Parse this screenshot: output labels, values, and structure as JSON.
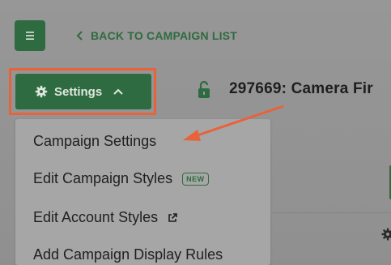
{
  "header": {
    "back_label": "BACK TO CAMPAIGN LIST"
  },
  "settings_button": {
    "label": "Settings"
  },
  "campaign": {
    "title": "297669: Camera Fir"
  },
  "dropdown": {
    "items": [
      {
        "label": "Campaign Settings"
      },
      {
        "label": "Edit Campaign Styles",
        "badge": "NEW"
      },
      {
        "label": "Edit Account Styles"
      },
      {
        "label": "Add Campaign Display Rules"
      }
    ]
  },
  "colors": {
    "brand_green": "#2f6b40",
    "annotation_orange": "#e8623a",
    "overlay_gray": "#939393"
  },
  "icons": [
    "menu-icon",
    "chevron-left-icon",
    "gear-icon",
    "chevron-up-icon",
    "lock-open-icon",
    "external-link-icon"
  ]
}
